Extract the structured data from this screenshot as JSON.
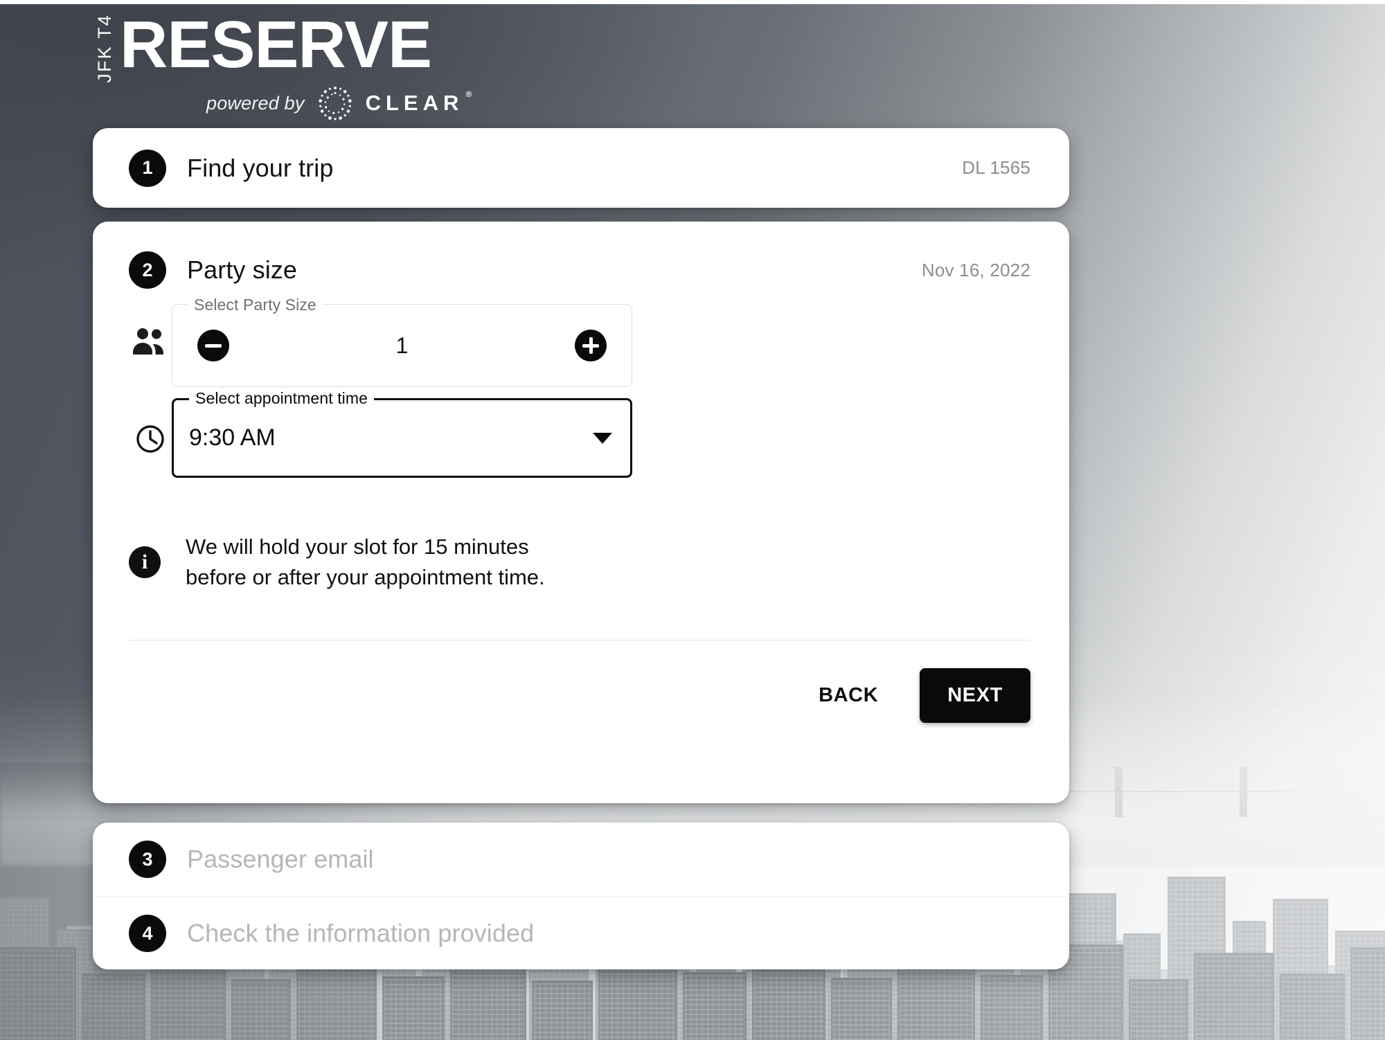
{
  "brand": {
    "airport": "JFK T4",
    "product": "RESERVE",
    "powered_by": "powered by",
    "partner": "CLEAR",
    "partner_mark": "clear-dots-icon",
    "registered_mark": "®",
    "header_bg": "#4d525c",
    "accent": "#0a0a0b"
  },
  "steps": [
    {
      "number": "1",
      "title": "Find your trip",
      "meta": "DL 1565",
      "state": "completed"
    },
    {
      "number": "2",
      "title": "Party size",
      "meta": "Nov 16, 2022",
      "state": "active"
    },
    {
      "number": "3",
      "title": "Passenger email",
      "meta": "",
      "state": "pending"
    },
    {
      "number": "4",
      "title": "Check the information provided",
      "meta": "",
      "state": "pending"
    }
  ],
  "party_size_field": {
    "legend": "Select Party Size",
    "icon": "people-icon",
    "value": "1",
    "decrement_icon": "minus-circle-icon",
    "increment_icon": "plus-circle-icon"
  },
  "appointment_time_field": {
    "legend": "Select appointment time",
    "icon": "clock-icon",
    "value": "9:30 AM",
    "caret_icon": "chevron-down-icon",
    "focused": true
  },
  "info_note": {
    "icon": "info-icon",
    "line1": "We will hold your slot for 15 minutes",
    "line2": "before or after your appointment time."
  },
  "actions": {
    "back_label": "BACK",
    "next_label": "NEXT"
  }
}
